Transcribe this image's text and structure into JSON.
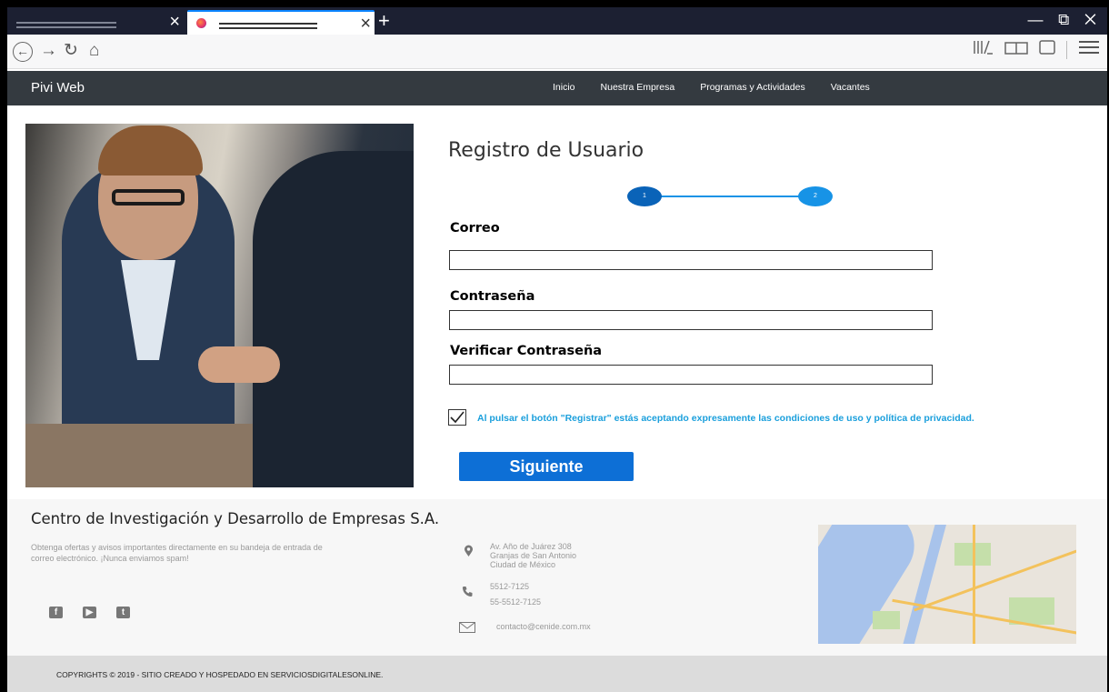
{
  "browser": {
    "tab_new": "+",
    "window_controls": "— ⧉ ✕"
  },
  "site": {
    "brand": "Pivi Web",
    "menu": [
      "Inicio",
      "Nuestra Empresa",
      "Programas y Actividades",
      "Vacantes"
    ]
  },
  "form": {
    "title": "Registro de Usuario",
    "steps": [
      "1",
      "2"
    ],
    "email_label": "Correo",
    "password_label": "Contraseña",
    "verify_label": "Verificar Contraseña",
    "email_value": "",
    "password_value": "",
    "verify_value": "",
    "terms_checked": true,
    "terms_text": "Al pulsar el botón \"Registrar\" estás aceptando expresamente las condiciones de uso y política de privacidad.",
    "next_label": "Siguiente"
  },
  "footer": {
    "title": "Centro de Investigación y Desarrollo de Empresas S.A.",
    "text": "Obtenga ofertas y avisos importantes directamente en su bandeja de entrada de correo electrónico. ¡Nunca enviamos spam!",
    "address": [
      "Av. Año de Juárez 308",
      "Granjas de San Antonio",
      "Ciudad de México"
    ],
    "phones": [
      "5512-7125",
      "55-5512-7125"
    ],
    "email": "contacto@cenide.com.mx",
    "copyright": "COPYRIGHTS © 2019 - SITIO CREADO Y HOSPEDADO EN SERVICIOSDIGITALESONLINE."
  },
  "icons": {
    "social": [
      "facebook-icon",
      "youtube-icon",
      "twitter-icon"
    ],
    "contact": [
      "location-pin-icon",
      "phone-icon",
      "envelope-icon"
    ]
  },
  "colors": {
    "nav_bg": "#343a40",
    "accent_blue": "#0d6fd6",
    "step_blue": "#1793e6",
    "terms_text": "#1a9fdc"
  }
}
